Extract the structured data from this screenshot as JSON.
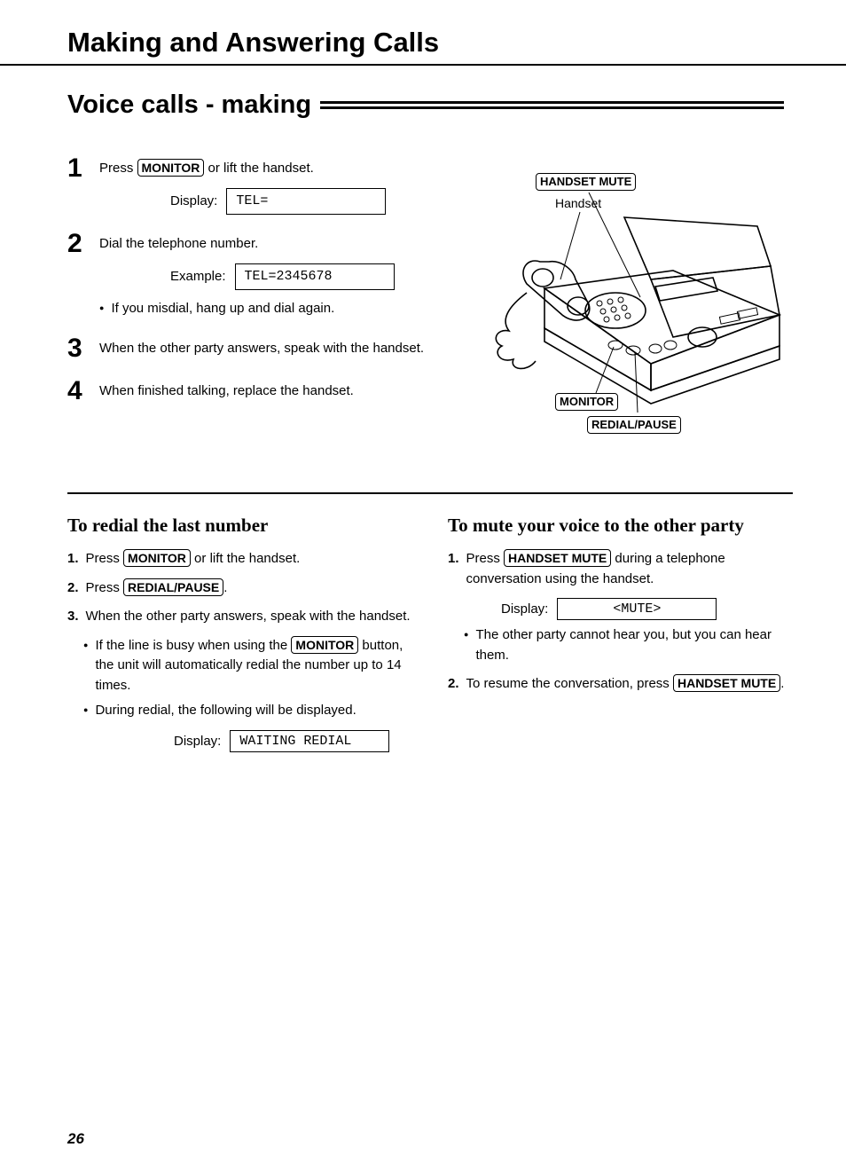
{
  "page_title": "Making and Answering Calls",
  "section_title": "Voice calls - making",
  "buttons": {
    "monitor": "MONITOR",
    "handset_mute": "HANDSET MUTE",
    "redial_pause": "REDIAL/PAUSE"
  },
  "steps": {
    "s1": {
      "num": "1",
      "text_a": "Press ",
      "text_b": " or lift the handset.",
      "display_label": "Display:",
      "display_value": "TEL="
    },
    "s2": {
      "num": "2",
      "text": "Dial the telephone number.",
      "example_label": "Example:",
      "example_value": "TEL=2345678",
      "bullet": "If you misdial, hang up and dial again."
    },
    "s3": {
      "num": "3",
      "text": "When the other party answers, speak with the handset."
    },
    "s4": {
      "num": "4",
      "text": "When finished talking, replace the handset."
    }
  },
  "figure": {
    "handset_mute": "HANDSET MUTE",
    "handset": "Handset",
    "monitor": "MONITOR",
    "redial_pause": "REDIAL/PAUSE"
  },
  "redial": {
    "title": "To redial the last number",
    "i1_a": "Press ",
    "i1_b": " or lift the handset.",
    "i2_a": "Press ",
    "i2_b": ".",
    "i3": "When the other party answers, speak with the handset.",
    "b1_a": "If the line is busy when using the ",
    "b1_b": " button, the unit will automatically redial the number up to 14 times.",
    "b2": "During redial, the following will be displayed.",
    "display_label": "Display:",
    "display_value": "WAITING REDIAL"
  },
  "mute": {
    "title": "To mute your voice to the other party",
    "i1_a": "Press ",
    "i1_b": " during a telephone conversation using the handset.",
    "display_label": "Display:",
    "display_value": "<MUTE>",
    "b1": "The other party cannot hear you, but you can hear them.",
    "i2_a": "To resume the conversation, press ",
    "i2_b": "."
  },
  "page_number": "26"
}
